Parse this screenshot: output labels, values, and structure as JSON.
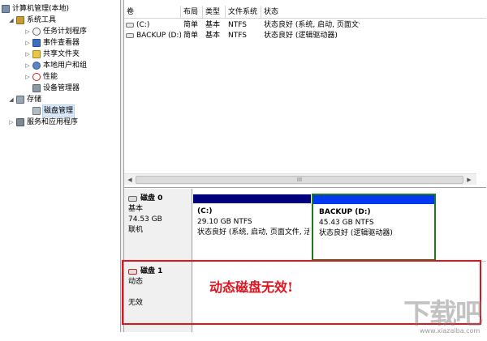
{
  "tree": {
    "root": "计算机管理(本地)",
    "system_tools": "系统工具",
    "task_scheduler": "任务计划程序",
    "event_viewer": "事件查看器",
    "shared_folders": "共享文件夹",
    "local_users": "本地用户和组",
    "performance": "性能",
    "device_manager": "设备管理器",
    "storage": "存储",
    "disk_management": "磁盘管理",
    "services": "服务和应用程序"
  },
  "columns": {
    "volume": "卷",
    "layout": "布局",
    "type": "类型",
    "fs": "文件系统",
    "status": "状态"
  },
  "volumes": [
    {
      "name": "(C:)",
      "layout": "简单",
      "type": "基本",
      "fs": "NTFS",
      "status": "状态良好 (系统, 启动, 页面文件"
    },
    {
      "name": "BACKUP (D:)",
      "layout": "简单",
      "type": "基本",
      "fs": "NTFS",
      "status": "状态良好 (逻辑驱动器)"
    }
  ],
  "scroll_thumb": "III",
  "disk0": {
    "title": "磁盘 0",
    "kind": "基本",
    "size": "74.53 GB",
    "state": "联机",
    "partitions": [
      {
        "name": "(C:)",
        "size": "29.10 GB NTFS",
        "status": "状态良好 (系统, 启动, 页面文件, 活"
      },
      {
        "name": "BACKUP  (D:)",
        "size": "45.43 GB NTFS",
        "status": "状态良好 (逻辑驱动器)"
      }
    ]
  },
  "disk1": {
    "title": "磁盘 1",
    "kind": "动态",
    "state": "无效"
  },
  "annotation": "动态磁盘无效!",
  "watermark": {
    "big": "下载吧",
    "small": "www.xiazaiba.com"
  },
  "colors": {
    "primary_bar": "#00007e",
    "logical_bar": "#0038f0",
    "selected_border": "#1e7a1e",
    "annotation_red": "#e0141e"
  }
}
